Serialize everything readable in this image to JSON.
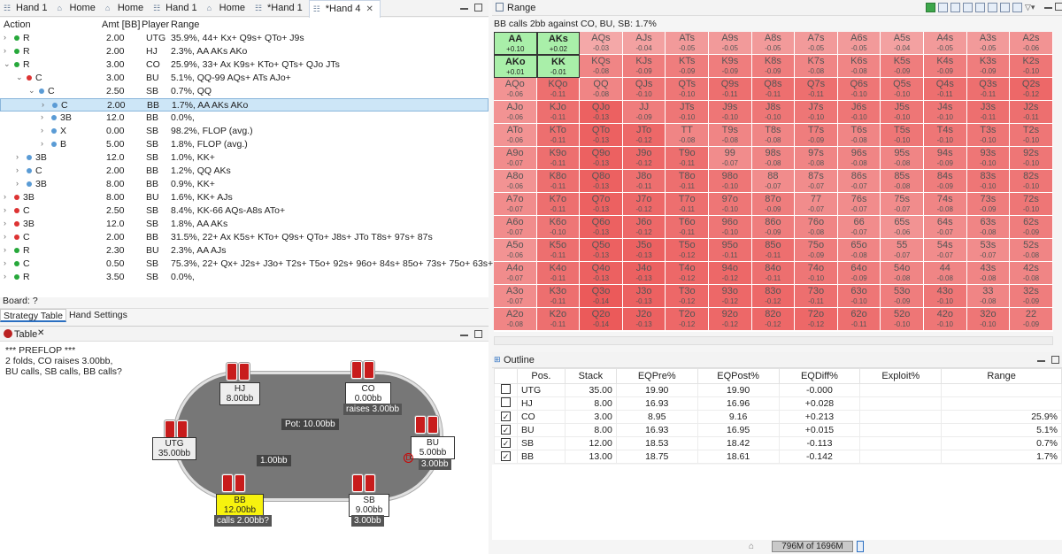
{
  "tabs": [
    {
      "label": "Hand 1",
      "icon": "hand-icon",
      "active": false
    },
    {
      "label": "Home",
      "icon": "home-icon",
      "active": false
    },
    {
      "label": "Home",
      "icon": "home-icon",
      "active": false
    },
    {
      "label": "Hand 1",
      "icon": "hand-icon",
      "active": false
    },
    {
      "label": "Home",
      "icon": "home-icon",
      "active": false
    },
    {
      "label": "*Hand 1",
      "icon": "hand-icon",
      "active": false
    },
    {
      "label": "*Hand 4",
      "icon": "hand-icon",
      "active": true
    }
  ],
  "tree_header": {
    "action": "Action",
    "amt": "Amt [BB]",
    "player": "Player",
    "range": "Range"
  },
  "tree_rows": [
    {
      "arrow": ">",
      "dot": "g",
      "action": "R",
      "amt": "2.00",
      "player": "UTG",
      "range": "35.9%, 44+ Kx+ Q9s+ QTo+ J9s",
      "indent": 0
    },
    {
      "arrow": ">",
      "dot": "g",
      "action": "R",
      "amt": "2.00",
      "player": "HJ",
      "range": "2.3%, AA AKs AKo",
      "indent": 0
    },
    {
      "arrow": "v",
      "dot": "g",
      "action": "R",
      "amt": "3.00",
      "player": "CO",
      "range": "25.9%, 33+ Ax K9s+ KTo+ QTs+ QJo JTs",
      "indent": 0
    },
    {
      "arrow": "v",
      "dot": "r",
      "action": "C",
      "amt": "3.00",
      "player": "BU",
      "range": "5.1%, QQ-99 AQs+ ATs AJo+",
      "indent": 1
    },
    {
      "arrow": "v",
      "dot": "b",
      "action": "C",
      "amt": "2.50",
      "player": "SB",
      "range": "0.7%, QQ",
      "indent": 2
    },
    {
      "arrow": ">",
      "dot": "b",
      "action": "C",
      "amt": "2.00",
      "player": "BB",
      "range": "1.7%, AA AKs AKo",
      "indent": 3,
      "selected": true
    },
    {
      "arrow": ">",
      "dot": "b",
      "action": "3B",
      "amt": "12.0",
      "player": "BB",
      "range": "0.0%,",
      "indent": 3
    },
    {
      "arrow": ">",
      "dot": "b",
      "action": "X",
      "amt": "0.00",
      "player": "SB",
      "range": "98.2%, FLOP (avg.)",
      "indent": 3
    },
    {
      "arrow": ">",
      "dot": "b",
      "action": "B",
      "amt": "5.00",
      "player": "SB",
      "range": "1.8%, FLOP (avg.)",
      "indent": 3
    },
    {
      "arrow": ">",
      "dot": "b",
      "action": "3B",
      "amt": "12.0",
      "player": "SB",
      "range": "1.0%, KK+",
      "indent": 1
    },
    {
      "arrow": ">",
      "dot": "b",
      "action": "C",
      "amt": "2.00",
      "player": "BB",
      "range": "1.2%, QQ AKs",
      "indent": 1
    },
    {
      "arrow": ">",
      "dot": "b",
      "action": "3B",
      "amt": "8.00",
      "player": "BB",
      "range": "0.9%, KK+",
      "indent": 1
    },
    {
      "arrow": ">",
      "dot": "r",
      "action": "3B",
      "amt": "8.00",
      "player": "BU",
      "range": "1.6%, KK+ AJs",
      "indent": 0
    },
    {
      "arrow": ">",
      "dot": "r",
      "action": "C",
      "amt": "2.50",
      "player": "SB",
      "range": "8.4%, KK-66 AQs-A8s ATo+",
      "indent": 0
    },
    {
      "arrow": ">",
      "dot": "r",
      "action": "3B",
      "amt": "12.0",
      "player": "SB",
      "range": "1.8%, AA AKs",
      "indent": 0
    },
    {
      "arrow": ">",
      "dot": "r",
      "action": "C",
      "amt": "2.00",
      "player": "BB",
      "range": "31.5%, 22+ Ax K5s+ KTo+ Q9s+ QTo+ J8s+ JTo T8s+ 97s+ 87s",
      "indent": 0
    },
    {
      "arrow": ">",
      "dot": "g",
      "action": "R",
      "amt": "2.30",
      "player": "BU",
      "range": "2.3%, AA AJs",
      "indent": 0
    },
    {
      "arrow": ">",
      "dot": "g",
      "action": "C",
      "amt": "0.50",
      "player": "SB",
      "range": "75.3%, 22+ Qx+ J2s+ J3o+ T2s+ T5o+ 92s+ 96o+ 84s+ 85o+ 73s+ 75o+ 63s+ 65o 52...",
      "indent": 0
    },
    {
      "arrow": ">",
      "dot": "g",
      "action": "R",
      "amt": "3.50",
      "player": "SB",
      "range": "0.0%,",
      "indent": 0
    }
  ],
  "board_label": "Board: ?",
  "subtabs": [
    "Strategy Table",
    "Hand Settings"
  ],
  "table_tab": "Table",
  "history": [
    "*** PREFLOP ***",
    "2 folds, CO raises 3.00bb, BU calls, SB calls, BB calls?"
  ],
  "seats": {
    "hj": {
      "name": "HJ",
      "stack": "8.00bb"
    },
    "co": {
      "name": "CO",
      "stack": "0.00bb",
      "action": "raises 3.00bb"
    },
    "utg": {
      "name": "UTG",
      "stack": "35.00bb"
    },
    "bu": {
      "name": "BU",
      "stack": "5.00bb",
      "action": "3.00bb"
    },
    "bb": {
      "name": "BB",
      "stack": "12.00bb",
      "action": "calls 2.00bb?"
    },
    "sb": {
      "name": "SB",
      "stack": "9.00bb",
      "action": "3.00bb"
    }
  },
  "pot": "Pot: 10.00bb",
  "bb_chip": "1.00bb",
  "range_tab": "Range",
  "range_title": "BB calls 2bb against CO, BU, SB: 1.7%",
  "ranks": [
    "A",
    "K",
    "Q",
    "J",
    "T",
    "9",
    "8",
    "7",
    "6",
    "5",
    "4",
    "3",
    "2"
  ],
  "grid_values": [
    [
      "+0.10",
      "+0.02",
      "-0.03",
      "-0.04",
      "-0.05",
      "-0.05",
      "-0.05",
      "-0.05",
      "-0.05",
      "-0.04",
      "-0.05",
      "-0.05",
      "-0.06"
    ],
    [
      "+0.01",
      "-0.01",
      "-0.08",
      "-0.09",
      "-0.09",
      "-0.09",
      "-0.09",
      "-0.08",
      "-0.08",
      "-0.09",
      "-0.09",
      "-0.09",
      "-0.10"
    ],
    [
      "-0.06",
      "-0.11",
      "-0.08",
      "-0.10",
      "-0.10",
      "-0.11",
      "-0.11",
      "-0.11",
      "-0.10",
      "-0.10",
      "-0.11",
      "-0.11",
      "-0.12"
    ],
    [
      "-0.06",
      "-0.11",
      "-0.13",
      "-0.09",
      "-0.10",
      "-0.10",
      "-0.10",
      "-0.10",
      "-0.10",
      "-0.10",
      "-0.10",
      "-0.11",
      "-0.11"
    ],
    [
      "-0.06",
      "-0.11",
      "-0.13",
      "-0.12",
      "-0.08",
      "-0.08",
      "-0.08",
      "-0.09",
      "-0.08",
      "-0.10",
      "-0.10",
      "-0.10",
      "-0.10"
    ],
    [
      "-0.07",
      "-0.11",
      "-0.13",
      "-0.12",
      "-0.11",
      "-0.07",
      "-0.08",
      "-0.08",
      "-0.08",
      "-0.08",
      "-0.09",
      "-0.10",
      "-0.10"
    ],
    [
      "-0.06",
      "-0.11",
      "-0.13",
      "-0.11",
      "-0.11",
      "-0.10",
      "-0.07",
      "-0.07",
      "-0.07",
      "-0.08",
      "-0.09",
      "-0.10",
      "-0.10"
    ],
    [
      "-0.07",
      "-0.11",
      "-0.13",
      "-0.12",
      "-0.11",
      "-0.10",
      "-0.09",
      "-0.07",
      "-0.07",
      "-0.07",
      "-0.08",
      "-0.09",
      "-0.10"
    ],
    [
      "-0.07",
      "-0.10",
      "-0.13",
      "-0.12",
      "-0.11",
      "-0.10",
      "-0.09",
      "-0.08",
      "-0.07",
      "-0.06",
      "-0.07",
      "-0.08",
      "-0.09"
    ],
    [
      "-0.06",
      "-0.11",
      "-0.13",
      "-0.13",
      "-0.12",
      "-0.11",
      "-0.11",
      "-0.09",
      "-0.08",
      "-0.07",
      "-0.07",
      "-0.07",
      "-0.08"
    ],
    [
      "-0.07",
      "-0.11",
      "-0.13",
      "-0.13",
      "-0.12",
      "-0.12",
      "-0.11",
      "-0.10",
      "-0.09",
      "-0.08",
      "-0.08",
      "-0.08",
      "-0.08"
    ],
    [
      "-0.07",
      "-0.11",
      "-0.14",
      "-0.13",
      "-0.12",
      "-0.12",
      "-0.12",
      "-0.11",
      "-0.10",
      "-0.09",
      "-0.10",
      "-0.08",
      "-0.09"
    ],
    [
      "-0.08",
      "-0.11",
      "-0.14",
      "-0.13",
      "-0.12",
      "-0.12",
      "-0.12",
      "-0.12",
      "-0.11",
      "-0.10",
      "-0.10",
      "-0.10",
      "-0.09"
    ]
  ],
  "in_range": [
    "AA",
    "AKs",
    "AKo",
    "KK"
  ],
  "outline_tab": "Outline",
  "outline_headers": [
    "",
    "Pos.",
    "Stack",
    "EQPre%",
    "EQPost%",
    "EQDiff%",
    "Exploit%",
    "Range"
  ],
  "outline_rows": [
    {
      "checked": false,
      "pos": "UTG",
      "stack": "35.00",
      "eqpre": "19.90",
      "eqpost": "19.90",
      "eqdiff": "-0.000",
      "exploit": "",
      "range": ""
    },
    {
      "checked": false,
      "pos": "HJ",
      "stack": "8.00",
      "eqpre": "16.93",
      "eqpost": "16.96",
      "eqdiff": "+0.028",
      "exploit": "",
      "range": ""
    },
    {
      "checked": true,
      "pos": "CO",
      "stack": "3.00",
      "eqpre": "8.95",
      "eqpost": "9.16",
      "eqdiff": "+0.213",
      "exploit": "",
      "range": "25.9%"
    },
    {
      "checked": true,
      "pos": "BU",
      "stack": "8.00",
      "eqpre": "16.93",
      "eqpost": "16.95",
      "eqdiff": "+0.015",
      "exploit": "",
      "range": "5.1%"
    },
    {
      "checked": true,
      "pos": "SB",
      "stack": "12.00",
      "eqpre": "18.53",
      "eqpost": "18.42",
      "eqdiff": "-0.113",
      "exploit": "",
      "range": "0.7%"
    },
    {
      "checked": true,
      "pos": "BB",
      "stack": "13.00",
      "eqpre": "18.75",
      "eqpost": "18.61",
      "eqdiff": "-0.142",
      "exploit": "",
      "range": "1.7%"
    }
  ],
  "memory": "796M of 1696M",
  "colors": {
    "in_range": "#a9efa9",
    "base_red": "#f08a8a",
    "selected": "#cde6f7"
  }
}
